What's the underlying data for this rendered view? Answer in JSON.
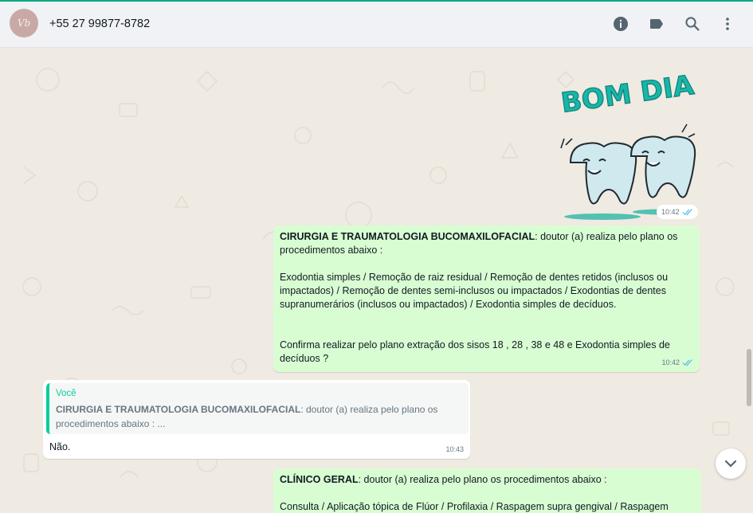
{
  "header": {
    "contact_name": "+55 27 99877-8782",
    "avatar_text": "Vb",
    "icons": [
      "info-icon",
      "label-icon",
      "search-icon",
      "menu-icon"
    ]
  },
  "colors": {
    "accent": "#00a884",
    "outgoing_bubble": "#d9fdd3",
    "incoming_bubble": "#ffffff",
    "chat_background": "#efeae2",
    "read_ticks": "#53bdeb"
  },
  "messages": [
    {
      "type": "sticker",
      "text": "BOM DIA",
      "time": "10:42"
    },
    {
      "type": "outgoing",
      "title": "CIRURGIA E TRAUMATOLOGIA BUCOMAXILOFACIAL",
      "intro": ":  doutor (a) realiza pelo plano os procedimentos abaixo :",
      "procedures": "Exodontia simples / Remoção de raiz residual  /  Remoção de dentes retidos (inclusos ou impactados) /  Remoção de dentes semi-inclusos ou  impactados /  Exodontias de dentes supranumerários (inclusos ou impactados) /  Exodontia simples de decíduos.",
      "question": "Confirma realizar pelo plano  extração dos sisos 18 , 28 , 38 e 48 e Exodontia simples de decíduos ?",
      "time": "10:42"
    },
    {
      "type": "incoming",
      "quote_author": "Você",
      "quote_title": "CIRURGIA E TRAUMATOLOGIA BUCOMAXILOFACIAL",
      "quote_text": ":  doutor (a) realiza pelo plano os procedimentos abaixo :    ...",
      "text": "Não.",
      "time": "10:43"
    },
    {
      "type": "outgoing",
      "title": "CLÍNICO GERAL",
      "intro": ":  doutor (a) realiza pelo plano os procedimentos abaixo :",
      "procedures": "Consulta /  Aplicação tópica de Flúor  /  Profilaxia / Raspagem supra gengival / Raspagem"
    }
  ]
}
